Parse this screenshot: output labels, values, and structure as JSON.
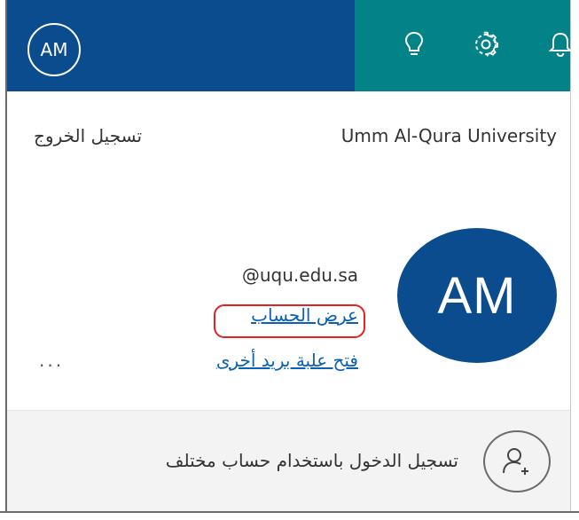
{
  "header": {
    "avatar_initials": "AM",
    "colors": {
      "account_bar": "#0b4c8f",
      "app_bar": "#038387"
    },
    "icons": [
      "lightbulb-icon",
      "gear-icon",
      "bell-icon"
    ]
  },
  "account": {
    "organization": "Umm Al-Qura University",
    "sign_out": "تسجيل الخروج",
    "avatar_initials": "AM",
    "email": "@uqu.edu.sa",
    "view_account": "عرض الحساب",
    "open_other_mailbox": "فتح علبة بريد أخرى",
    "more": "...",
    "accent_color": "#0b61b5",
    "highlight_color": "#e52121"
  },
  "footer": {
    "sign_in_different": "تسجيل الدخول باستخدام حساب مختلف",
    "icon": "add-person-icon"
  }
}
